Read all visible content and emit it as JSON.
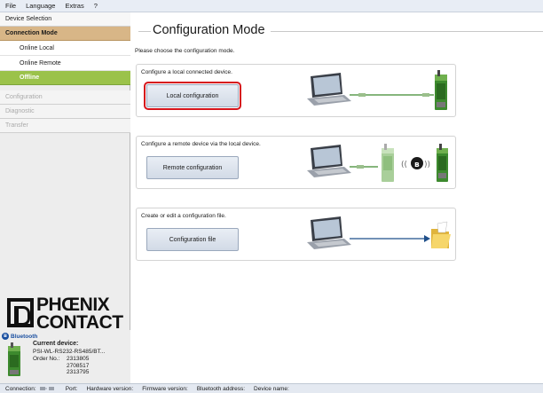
{
  "menu": [
    "File",
    "Language",
    "Extras",
    "?"
  ],
  "sidebar": {
    "device_selection": "Device Selection",
    "connection_mode": "Connection Mode",
    "online_local": "Online Local",
    "online_remote": "Online Remote",
    "offline": "Offline",
    "configuration": "Configuration",
    "diagnostic": "Diagnostic",
    "transfer": "Transfer"
  },
  "logo": {
    "line1": "PHŒNIX",
    "line2": "CONTACT"
  },
  "device": {
    "bluetooth_label": "Bluetooth",
    "current_label": "Current device:",
    "name": "PSI-WL-RS232-RS485/BT...",
    "order_label": "Order No.:",
    "order_numbers": [
      "2313805",
      "2708517",
      "2313795"
    ]
  },
  "main": {
    "title": "Configuration Mode",
    "subtitle": "Please choose the configuration mode.",
    "cards": [
      {
        "desc": "Configure a local connected device.",
        "button": "Local configuration"
      },
      {
        "desc": "Configure a remote device via the local device.",
        "button": "Remote configuration"
      },
      {
        "desc": "Create or edit a configuration file.",
        "button": "Configuration file"
      }
    ]
  },
  "status": {
    "connection": "Connection:",
    "port": "Port:",
    "hw_version": "Hardware version:",
    "fw_version": "Firmware version:",
    "bt_address": "Bluetooth address:",
    "device_name": "Device name:"
  },
  "colors": {
    "accent_mode": "#d8b687",
    "active_green": "#9bc24a",
    "highlight_red": "#d6141b",
    "device_green": "#3d8a2e"
  }
}
